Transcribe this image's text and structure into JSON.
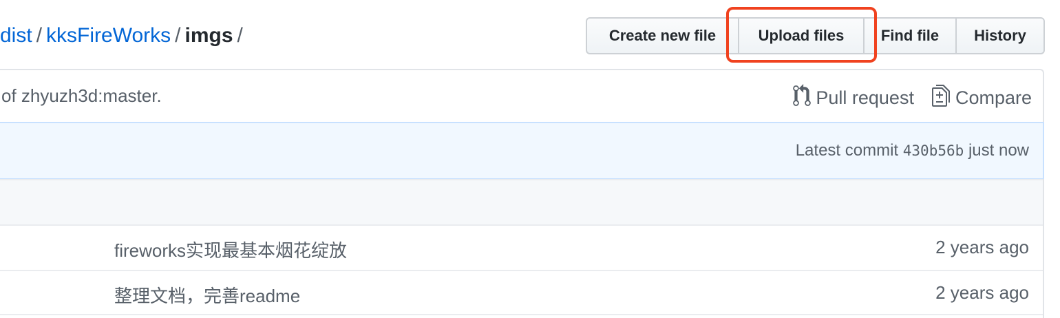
{
  "breadcrumb": {
    "parts": [
      "dist",
      "kksFireWorks",
      "imgs"
    ],
    "separator": "/"
  },
  "toolbar": {
    "create_label": "Create new file",
    "upload_label": "Upload files",
    "find_label": "Find file",
    "history_label": "History"
  },
  "branch": {
    "text": "of zhyuzh3d:master.",
    "pull_request_label": "Pull request",
    "compare_label": "Compare"
  },
  "commit": {
    "prefix": "Latest commit",
    "sha": "430b56b",
    "time": "just now"
  },
  "files": [
    {
      "message": "fireworks实现最基本烟花绽放",
      "age": "2 years ago"
    },
    {
      "message": "整理文档，完善readme",
      "age": "2 years ago"
    }
  ],
  "colors": {
    "link": "#0366d6",
    "highlight": "#f0421f",
    "commit_bg": "#f1f8ff"
  },
  "icons": [
    "git-pull-request-icon",
    "diff-icon"
  ]
}
